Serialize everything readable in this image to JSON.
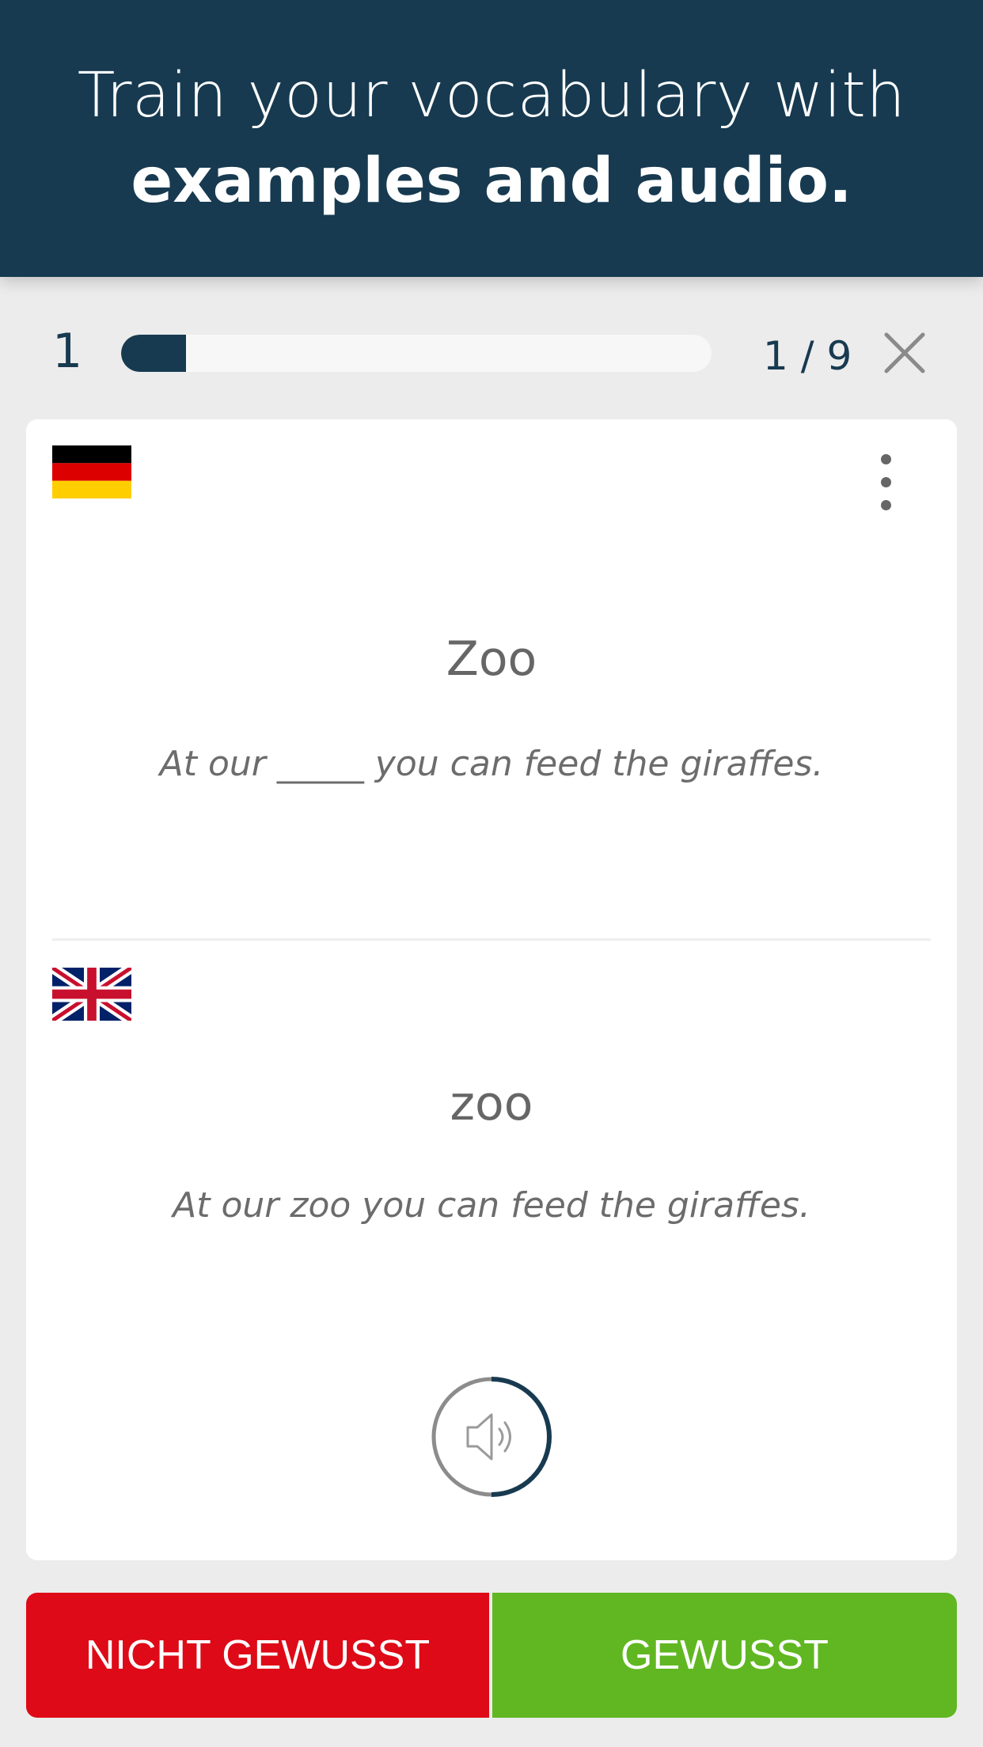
{
  "banner": {
    "line1": "Train your vocabulary with",
    "line2": "examples and audio."
  },
  "progress": {
    "level": "1",
    "counter": "1 / 9",
    "fraction": 0.11
  },
  "card": {
    "source_language_flag": "germany-flag-icon",
    "target_language_flag": "uk-flag-icon",
    "source_word": "Zoo",
    "source_example": "At our _____ you can feed the giraffes.",
    "target_word": "zoo",
    "target_example": "At our zoo you can feed the giraffes.",
    "audio_icon": "speaker-icon"
  },
  "actions": {
    "not_known_label": "NICHT GEWUSST",
    "known_label": "GEWUSST"
  },
  "colors": {
    "navy": "#173a50",
    "red": "#de0a17",
    "green": "#61b722"
  }
}
